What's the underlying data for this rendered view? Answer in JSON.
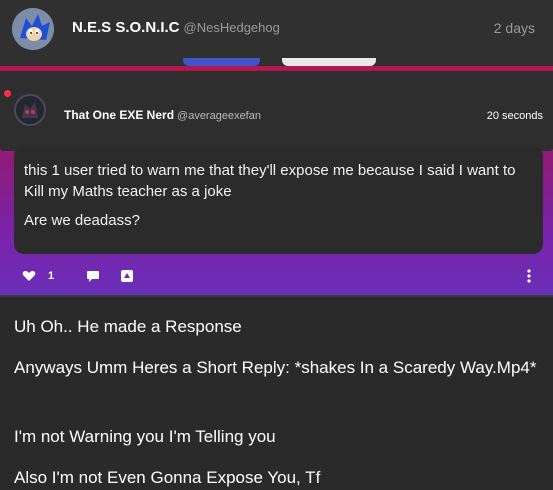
{
  "post": {
    "author_name": "N.E.S S.O.N.I.C",
    "author_handle": "@NesHedgehog",
    "timestamp": "2 days"
  },
  "quoted": {
    "author_name": "That One EXE Nerd",
    "author_handle": "@averageexefan",
    "timestamp": "20 seconds",
    "lines": [
      "this 1 user tried to warn me that they'll expose me because I said I want to Kill my Maths teacher as a joke",
      "Are we deadass?"
    ],
    "like_count": "1"
  },
  "reply_lines": [
    "Uh Oh.. He made a Response",
    "Anyways Umm Heres a Short Reply: *shakes In a Scaredy Way.Mp4*",
    "I'm not Warning you I'm Telling you",
    "Also I'm not Even Gonna Expose You, Tf"
  ],
  "icons": [
    "avatar-sonic",
    "avatar-exe",
    "heart-icon",
    "comment-icon",
    "share-icon",
    "more-icon"
  ],
  "colors": {
    "background": "#2a2a2a",
    "embed_gradient_top": "#b4164f",
    "embed_gradient_bottom": "#6a2fb8",
    "accent_tab": "#3f55c8"
  }
}
